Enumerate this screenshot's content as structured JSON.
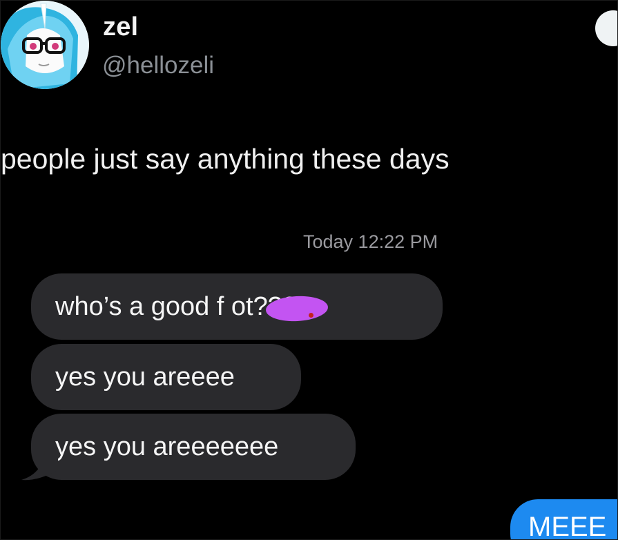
{
  "user": {
    "display_name": "zel",
    "handle": "@hellozeli"
  },
  "tweet": {
    "text": "people just say anything these days"
  },
  "screenshot": {
    "timestamp": "Today 12:22 PM",
    "messages": [
      "who’s a good f           ot????",
      "yes you areeee",
      "yes you areeeeeee"
    ],
    "sent_partial": "MEEE",
    "colors": {
      "received_bubble": "#2a2a2d",
      "sent_bubble": "#1d8af0",
      "redaction": "#c354f2"
    }
  },
  "icons": {
    "avatar": "pony-avatar-with-glasses",
    "follow": "follow-button"
  }
}
